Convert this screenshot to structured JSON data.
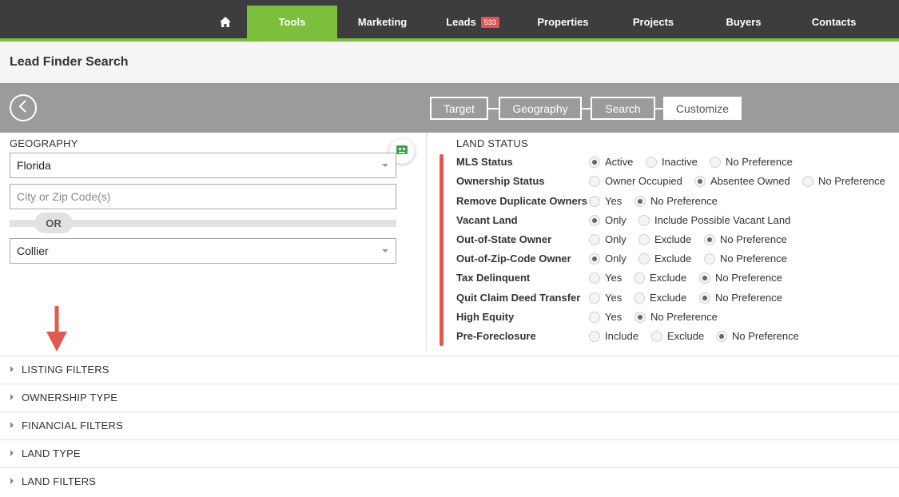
{
  "nav": {
    "items": [
      {
        "key": "home",
        "label": "",
        "icon": "home-icon"
      },
      {
        "key": "tools",
        "label": "Tools",
        "active": true
      },
      {
        "key": "marketing",
        "label": "Marketing"
      },
      {
        "key": "leads",
        "label": "Leads",
        "badge": "533"
      },
      {
        "key": "properties",
        "label": "Properties"
      },
      {
        "key": "projects",
        "label": "Projects"
      },
      {
        "key": "buyers",
        "label": "Buyers"
      },
      {
        "key": "contacts",
        "label": "Contacts"
      }
    ],
    "colors": {
      "bar": "#3d3d3d",
      "accent": "#7cbf3c",
      "badge": "#e05555"
    }
  },
  "page": {
    "title": "Lead Finder Search"
  },
  "steps": {
    "back_icon": "chevron-left-icon",
    "items": [
      "Target",
      "Geography",
      "Search",
      "Customize"
    ],
    "active": "Customize"
  },
  "geography": {
    "label": "GEOGRAPHY",
    "state_value": "Florida",
    "city_zip_placeholder": "City or Zip Code(s)",
    "or_label": "OR",
    "county_value": "Collier",
    "assistant_icon": "robot-icon"
  },
  "land_status": {
    "heading": "LAND STATUS",
    "rows": [
      {
        "label": "MLS Status",
        "options": [
          "Active",
          "Inactive",
          "No Preference"
        ],
        "selected": "Active"
      },
      {
        "label": "Ownership Status",
        "options": [
          "Owner Occupied",
          "Absentee Owned",
          "No Preference"
        ],
        "selected": "Absentee Owned"
      },
      {
        "label": "Remove Duplicate Owners",
        "options": [
          "Yes",
          "No Preference"
        ],
        "selected": "No Preference"
      },
      {
        "label": "Vacant Land",
        "options": [
          "Only",
          "Include Possible Vacant Land"
        ],
        "selected": "Only"
      },
      {
        "label": "Out-of-State Owner",
        "options": [
          "Only",
          "Exclude",
          "No Preference"
        ],
        "selected": "No Preference"
      },
      {
        "label": "Out-of-Zip-Code Owner",
        "options": [
          "Only",
          "Exclude",
          "No Preference"
        ],
        "selected": "Only"
      },
      {
        "label": "Tax Delinquent",
        "options": [
          "Yes",
          "Exclude",
          "No Preference"
        ],
        "selected": "No Preference"
      },
      {
        "label": "Quit Claim Deed Transfer",
        "options": [
          "Yes",
          "Exclude",
          "No Preference"
        ],
        "selected": "No Preference"
      },
      {
        "label": "High Equity",
        "options": [
          "Yes",
          "No Preference"
        ],
        "selected": "No Preference"
      },
      {
        "label": "Pre-Foreclosure",
        "options": [
          "Include",
          "Exclude",
          "No Preference"
        ],
        "selected": "No Preference"
      }
    ]
  },
  "filters": {
    "sections": [
      "LISTING FILTERS",
      "OWNERSHIP TYPE",
      "FINANCIAL FILTERS",
      "LAND TYPE",
      "LAND FILTERS"
    ]
  },
  "annotations": {
    "highlight_color": "#e05a4e"
  }
}
